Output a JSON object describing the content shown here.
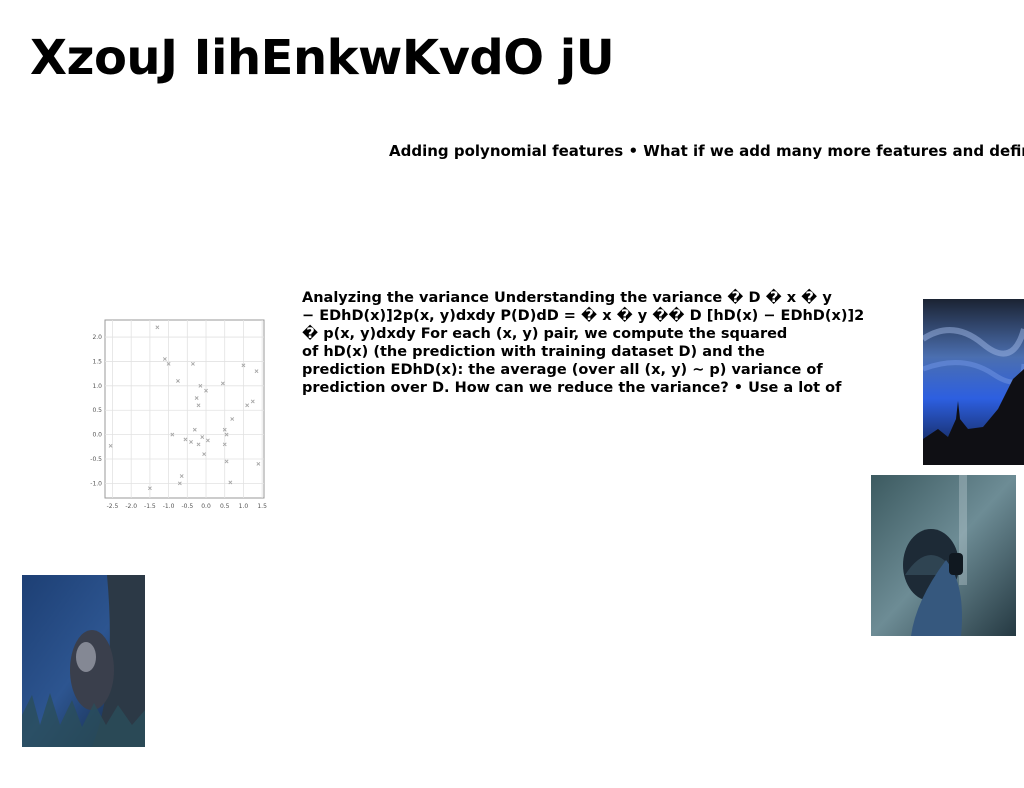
{
  "slide": {
    "title": "XzouJ IihEnkwKvdO jU",
    "subtitle": "Adding polynomial features • What if we add many more features and define",
    "body_lines": [
      "Analyzing the variance Understanding the variance � D � x � y",
      "− EDhD(x)]2p(x, y)dxdy P(D)dD = � x � y �� D [hD(x) − EDhD(x)]2",
      "� p(x, y)dxdy For each (x, y) pair, we compute the squared",
      "of hD(x) (the prediction with training dataset D) and the",
      "prediction EDhD(x): the average (over all (x, y) ∼ p) variance of",
      "prediction over D. How can we reduce the variance? • Use a lot of"
    ]
  },
  "chart_data": {
    "type": "scatter",
    "marker": "x",
    "grid": true,
    "xlim": [
      -2.7,
      1.55
    ],
    "ylim": [
      -1.3,
      2.35
    ],
    "xticks": [
      "-2.5",
      "-2.0",
      "-1.5",
      "-1.0",
      "-0.5",
      "0.0",
      "0.5",
      "1.0",
      "1.5"
    ],
    "yticks": [
      "2.0",
      "1.5",
      "1.0",
      "0.5",
      "0.0",
      "-0.5",
      "-1.0"
    ],
    "points": [
      [
        -2.55,
        -0.23
      ],
      [
        -1.5,
        -1.1
      ],
      [
        -1.3,
        2.2
      ],
      [
        -1.1,
        1.55
      ],
      [
        -1.0,
        1.45
      ],
      [
        -0.9,
        0.0
      ],
      [
        -0.75,
        1.1
      ],
      [
        -0.7,
        -1.0
      ],
      [
        -0.65,
        -0.85
      ],
      [
        -0.55,
        -0.1
      ],
      [
        -0.4,
        -0.15
      ],
      [
        -0.35,
        1.45
      ],
      [
        -0.3,
        0.1
      ],
      [
        -0.25,
        0.75
      ],
      [
        -0.2,
        0.6
      ],
      [
        -0.2,
        -0.2
      ],
      [
        -0.15,
        1.0
      ],
      [
        -0.1,
        -0.05
      ],
      [
        -0.05,
        -0.4
      ],
      [
        0.0,
        0.9
      ],
      [
        0.05,
        -0.12
      ],
      [
        0.45,
        1.05
      ],
      [
        0.5,
        0.1
      ],
      [
        0.5,
        -0.2
      ],
      [
        0.55,
        0.0
      ],
      [
        0.55,
        -0.55
      ],
      [
        0.65,
        -0.98
      ],
      [
        0.7,
        0.32
      ],
      [
        1.0,
        1.42
      ],
      [
        1.1,
        0.6
      ],
      [
        1.25,
        0.68
      ],
      [
        1.35,
        1.3
      ],
      [
        1.4,
        -0.6
      ]
    ]
  },
  "images": {
    "photo_1": "blue-sky-castle-silhouette",
    "photo_2": "person-holding-camera",
    "photo_3": "small-animal-by-tree-trunk"
  }
}
